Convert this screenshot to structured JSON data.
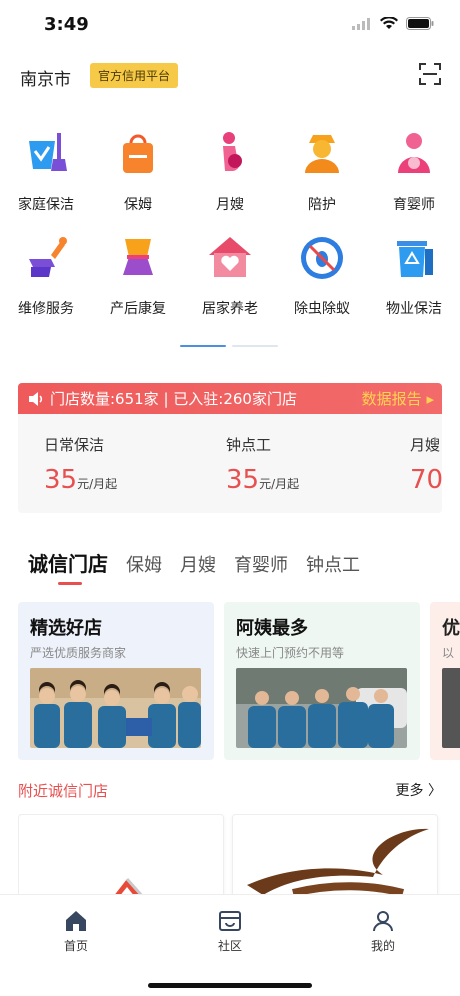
{
  "status_bar": {
    "time": "3:49"
  },
  "header": {
    "city": "南京市",
    "badge": "官方信用平台"
  },
  "services": {
    "row1": [
      {
        "label": "家庭保洁",
        "icon": "cleaning-bucket-icon"
      },
      {
        "label": "保姆",
        "icon": "shopping-bag-icon"
      },
      {
        "label": "月嫂",
        "icon": "pregnant-woman-icon"
      },
      {
        "label": "陪护",
        "icon": "caregiver-icon"
      },
      {
        "label": "育婴师",
        "icon": "mother-baby-icon"
      }
    ],
    "row2": [
      {
        "label": "维修服务",
        "icon": "wrench-hand-icon"
      },
      {
        "label": "产后康复",
        "icon": "waist-icon"
      },
      {
        "label": "居家养老",
        "icon": "house-heart-icon"
      },
      {
        "label": "除虫除蚁",
        "icon": "no-bug-icon"
      },
      {
        "label": "物业保洁",
        "icon": "recycle-bin-icon"
      }
    ]
  },
  "stats": {
    "banner": "门店数量:651家 | 已入驻:260家门店",
    "report_link": "数据报告",
    "prices": [
      {
        "name": "日常保洁",
        "value": "35",
        "unit": "元/月起"
      },
      {
        "name": "钟点工",
        "value": "35",
        "unit": "元/月起"
      },
      {
        "name": "月嫂",
        "value": "70",
        "unit": ""
      }
    ]
  },
  "tabs": [
    "诚信门店",
    "保姆",
    "月嫂",
    "育婴师",
    "钟点工"
  ],
  "promos": [
    {
      "title": "精选好店",
      "subtitle": "严选优质服务商家"
    },
    {
      "title": "阿姨最多",
      "subtitle": "快速上门预约不用等"
    },
    {
      "title": "优",
      "subtitle": "以"
    }
  ],
  "nearby": {
    "title": "附近诚信门店",
    "more": "更多"
  },
  "tab_bar": [
    {
      "label": "首页",
      "icon": "home-icon"
    },
    {
      "label": "社区",
      "icon": "community-icon"
    },
    {
      "label": "我的",
      "icon": "profile-icon"
    }
  ],
  "colors": {
    "accent_red": "#e85050",
    "badge_yellow": "#f7c948",
    "pager_blue": "#4a8fe0"
  }
}
